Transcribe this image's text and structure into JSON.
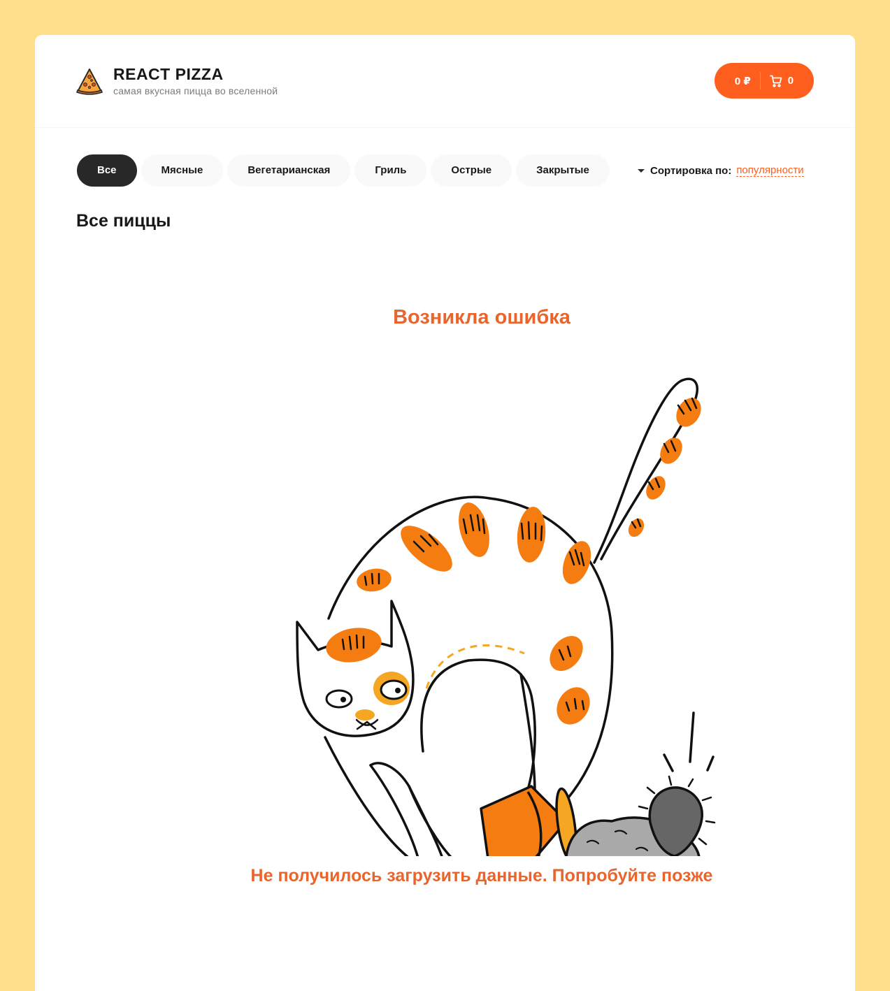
{
  "header": {
    "title": "REACT PIZZA",
    "subtitle": "самая вкусная пицца во вселенной",
    "cart": {
      "price": "0 ₽",
      "count": "0"
    }
  },
  "categories": [
    "Все",
    "Мясные",
    "Вегетарианская",
    "Гриль",
    "Острые",
    "Закрытые"
  ],
  "active_category": "Все",
  "sort": {
    "label": "Сортировка по:",
    "value": "популярности"
  },
  "content": {
    "title": "Все пиццы"
  },
  "error": {
    "title": "Возникла ошибка",
    "message": "Не получилось загрузить данные. Попробуйте позже"
  },
  "colors": {
    "accent": "#FE5F1E",
    "error_text": "#E9652C",
    "background": "#FFDF8C",
    "dark": "#282828"
  },
  "icons": {
    "logo": "pizza-slice-icon",
    "cart": "cart-icon",
    "sort": "sort-arrow-icon",
    "illustration": "cat-knocking-over-cactus-illustration"
  }
}
